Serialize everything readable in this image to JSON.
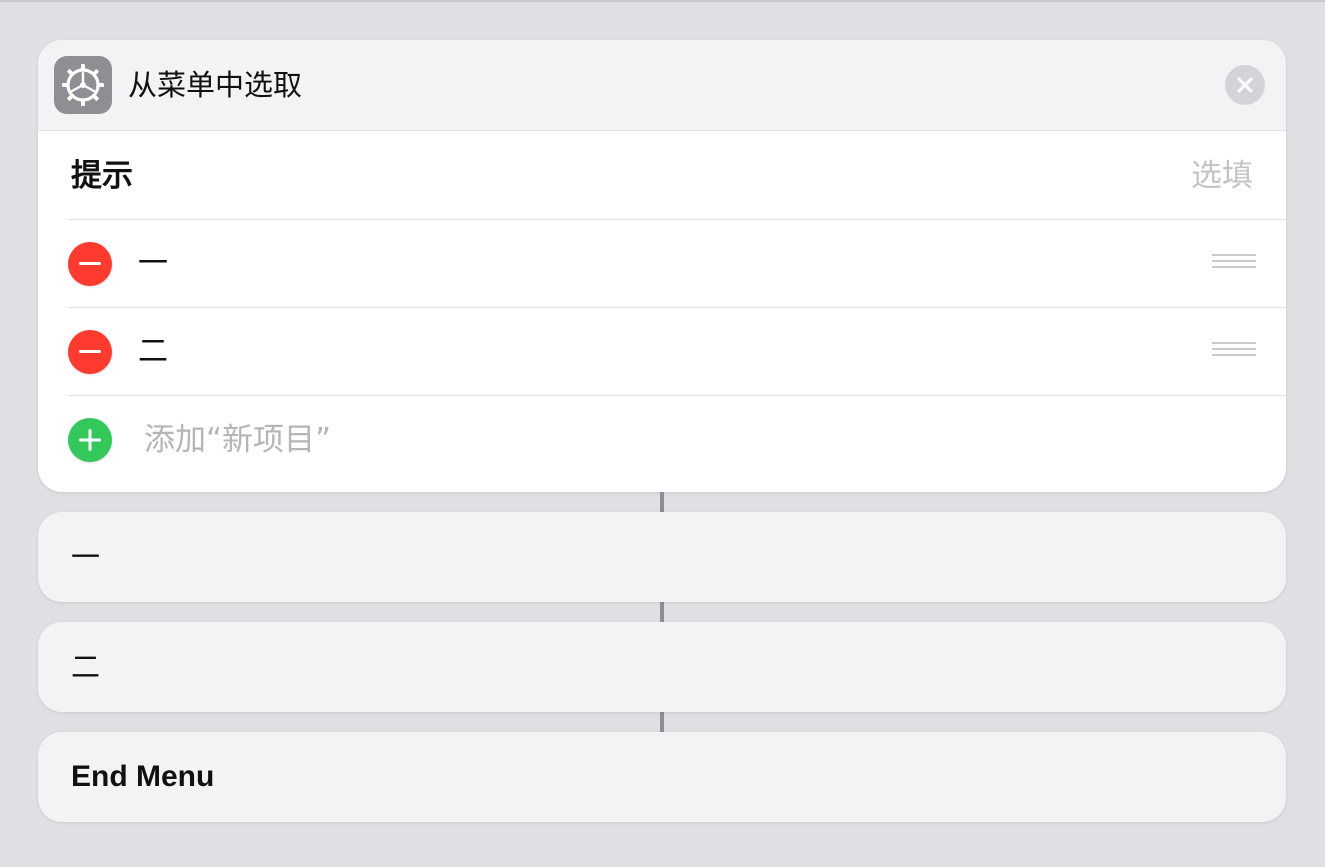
{
  "action": {
    "title": "从菜单中选取",
    "icon": "gear-icon",
    "icon_bg": "#8e8e93",
    "prompt": {
      "label": "提示",
      "placeholder": "选填"
    },
    "items": [
      {
        "label": "一"
      },
      {
        "label": "二"
      }
    ],
    "add_item_label": "添加“新项目”"
  },
  "menu_blocks": [
    {
      "label": "一"
    },
    {
      "label": "二"
    },
    {
      "label": "End Menu"
    }
  ],
  "colors": {
    "remove": "#ff3b30",
    "add": "#34c759",
    "background": "#dfe0e3",
    "card": "#f2f3f5"
  }
}
